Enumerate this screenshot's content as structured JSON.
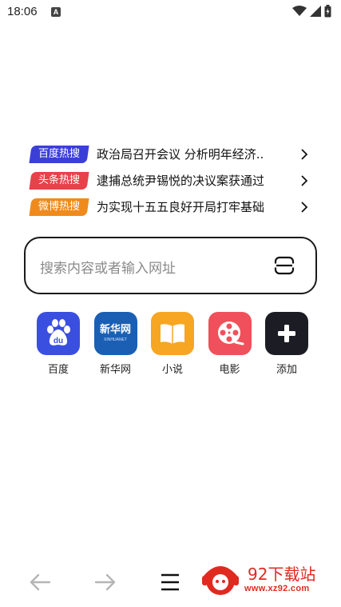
{
  "status": {
    "time": "18:06",
    "notification_letter": "A"
  },
  "hot_searches": [
    {
      "tag": "百度热搜",
      "color": "#3b3fd8",
      "text": "政治局召开会议 分析明年经济.."
    },
    {
      "tag": "头条热搜",
      "color": "#e8414a",
      "text": "逮捕总统尹锡悦的决议案获通过"
    },
    {
      "tag": "微博热搜",
      "color": "#f08a1c",
      "text": "为实现十五五良好开局打牢基础"
    }
  ],
  "search": {
    "placeholder": "搜索内容或者输入网址"
  },
  "shortcuts": [
    {
      "label": "百度",
      "icon": "baidu-icon",
      "color": "#3a4fe0"
    },
    {
      "label": "新华网",
      "icon": "xinhua-icon",
      "color": "#1a5fb4",
      "logo_text": "新华网",
      "logo_sub": "XINHUANET"
    },
    {
      "label": "小说",
      "icon": "book-icon",
      "color": "#f6a623"
    },
    {
      "label": "电影",
      "icon": "film-reel-icon",
      "color": "#f0505b"
    },
    {
      "label": "添加",
      "icon": "add-icon",
      "color": "#1c1c24"
    }
  ],
  "watermark": {
    "title": "92下载站",
    "url": "www.xz92.com"
  }
}
